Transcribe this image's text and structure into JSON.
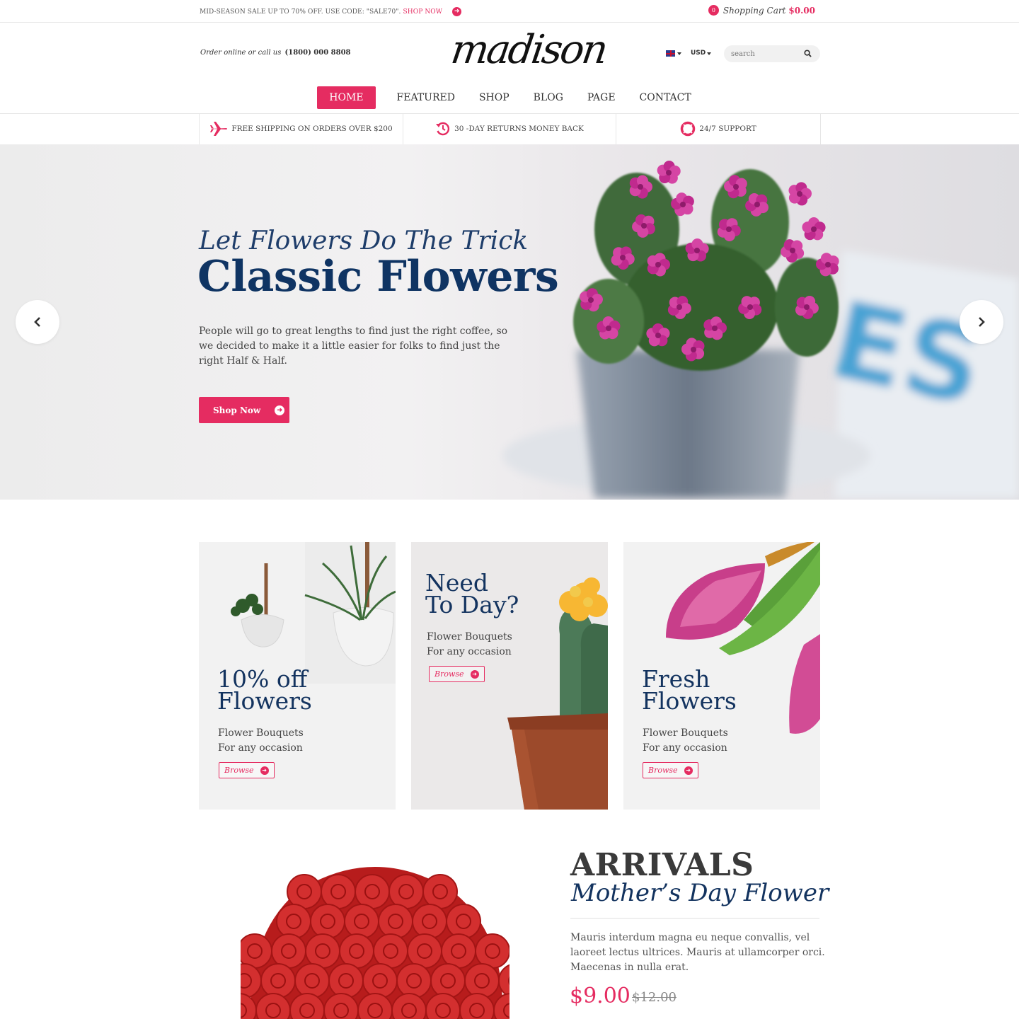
{
  "topbar": {
    "promo_text": "MID-SEASON SALE UP TO 70% OFF. USE CODE: \"SALE70\".",
    "promo_link": "SHOP NOW",
    "promo_icon": "arrow-circle-right-icon",
    "cart_count": "0",
    "cart_label": "Shopping Cart",
    "cart_amount": "$0.00"
  },
  "header": {
    "order_text": "Order online or call us",
    "phone": "(1800) 000 8808",
    "logo": "madison",
    "currency": "USD",
    "search_placeholder": "search",
    "search_icon": "search-icon",
    "language_icon": "uk-flag-icon"
  },
  "nav": {
    "items": [
      {
        "label": "HOME",
        "active": true
      },
      {
        "label": "FEATURED"
      },
      {
        "label": "SHOP"
      },
      {
        "label": "BLOG"
      },
      {
        "label": "PAGE"
      },
      {
        "label": "CONTACT"
      }
    ]
  },
  "features": [
    {
      "icon": "airplane-icon",
      "text": "FREE SHIPPING ON ORDERS OVER $200"
    },
    {
      "icon": "history-icon",
      "text": "30 -DAY RETURNS MONEY BACK"
    },
    {
      "icon": "lifebuoy-icon",
      "text": "24/7 SUPPORT"
    }
  ],
  "hero": {
    "kicker": "Let Flowers Do The Trick",
    "headline": "Classic Flowers",
    "description": "People will go to great lengths to find just the right coffee, so we decided to make it a little easier for folks to find just the right Half & Half.",
    "button": "Shop Now",
    "prev_icon": "chevron-left-icon",
    "next_icon": "chevron-right-icon"
  },
  "cards": [
    {
      "title": "10% off\nFlowers",
      "subtitle": "Flower Bouquets\nFor any occasion",
      "button": "Browse"
    },
    {
      "title": "Need\nTo Day?",
      "subtitle": "Flower Bouquets\nFor any occasion",
      "button": "Browse"
    },
    {
      "title": "Fresh\nFlowers",
      "subtitle": "Flower Bouquets\nFor any occasion",
      "button": "Browse"
    }
  ],
  "arrivals": {
    "title": "ARRIVALS",
    "subtitle": "Mother’s Day Flower",
    "description": "Mauris interdum magna eu neque convallis, vel laoreet lectus ultrices. Mauris at ullamcorper orci. Maecenas in nulla erat.",
    "price": "$9.00",
    "old_price": "$12.00"
  },
  "colors": {
    "accent": "#e52c61",
    "navy": "#13335f"
  }
}
